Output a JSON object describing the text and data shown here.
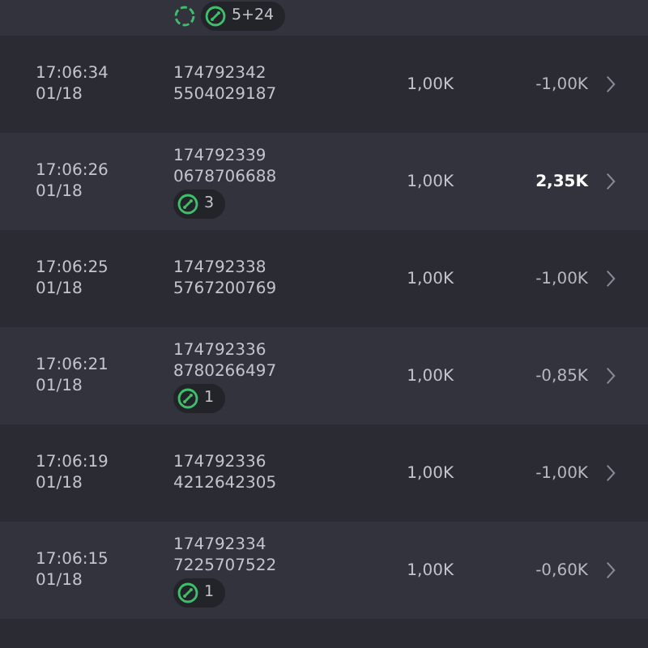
{
  "top_row": {
    "badges": [
      {
        "kind": "loading"
      },
      {
        "kind": "count",
        "count": "5+24"
      }
    ]
  },
  "rows": [
    {
      "time": "17:06:34",
      "date": "01/18",
      "id_line_1": "174792342",
      "id_line_2": "5504029187",
      "amount": "1,00K",
      "result": "-1,00K",
      "positive": false,
      "badges": []
    },
    {
      "time": "17:06:26",
      "date": "01/18",
      "id_line_1": "174792339",
      "id_line_2": "0678706688",
      "amount": "1,00K",
      "result": "2,35K",
      "positive": true,
      "badges": [
        {
          "kind": "count",
          "count": "3"
        }
      ]
    },
    {
      "time": "17:06:25",
      "date": "01/18",
      "id_line_1": "174792338",
      "id_line_2": "5767200769",
      "amount": "1,00K",
      "result": "-1,00K",
      "positive": false,
      "badges": []
    },
    {
      "time": "17:06:21",
      "date": "01/18",
      "id_line_1": "174792336",
      "id_line_2": "8780266497",
      "amount": "1,00K",
      "result": "-0,85K",
      "positive": false,
      "badges": [
        {
          "kind": "count",
          "count": "1"
        }
      ]
    },
    {
      "time": "17:06:19",
      "date": "01/18",
      "id_line_1": "174792336",
      "id_line_2": "4212642305",
      "amount": "1,00K",
      "result": "-1,00K",
      "positive": false,
      "badges": []
    },
    {
      "time": "17:06:15",
      "date": "01/18",
      "id_line_1": "174792334",
      "id_line_2": "7225707522",
      "amount": "1,00K",
      "result": "-0,60K",
      "positive": false,
      "badges": [
        {
          "kind": "count",
          "count": "1"
        }
      ]
    }
  ]
}
